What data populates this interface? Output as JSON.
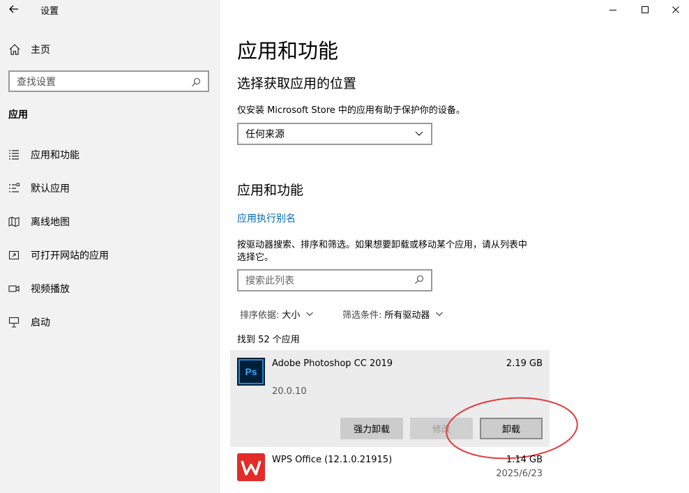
{
  "window": {
    "title": "设置",
    "controls": [
      "minimize-icon",
      "maximize-icon",
      "close-icon"
    ]
  },
  "sidebar": {
    "home_label": "主页",
    "search_placeholder": "查找设置",
    "section": "应用",
    "items": [
      {
        "label": "应用和功能",
        "icon": "apps-list-icon"
      },
      {
        "label": "默认应用",
        "icon": "default-apps-icon"
      },
      {
        "label": "离线地图",
        "icon": "map-icon"
      },
      {
        "label": "可打开网站的应用",
        "icon": "open-website-icon"
      },
      {
        "label": "视频播放",
        "icon": "video-icon"
      },
      {
        "label": "启动",
        "icon": "startup-icon"
      }
    ]
  },
  "main": {
    "page_title": "应用和功能",
    "location_heading": "选择获取应用的位置",
    "location_desc": "仅安装 Microsoft Store 中的应用有助于保护你的设备。",
    "location_value": "任何来源",
    "apps_heading": "应用和功能",
    "alias_link": "应用执行别名",
    "apps_desc_line1": "按驱动器搜索、排序和筛选。如果想要卸载或移动某个应用，请从列表中",
    "apps_desc_line2": "选择它。",
    "search_placeholder": "搜索此列表",
    "sort_label": "排序依据:",
    "sort_value": "大小",
    "filter_label": "筛选条件:",
    "filter_value": "所有驱动器",
    "count_text": "找到 52 个应用",
    "apps": [
      {
        "name": "Adobe Photoshop CC 2019",
        "size": "2.19 GB",
        "version": "20.0.10",
        "icon_text": "Ps",
        "buttons": {
          "force_uninstall": "强力卸载",
          "modify": "修改",
          "uninstall": "卸载"
        }
      },
      {
        "name": "WPS Office (12.1.0.21915)",
        "size": "1.14 GB",
        "date": "2025/6/23"
      }
    ]
  },
  "colors": {
    "accent_link": "#0067b8",
    "ps_icon_bg": "#001e36",
    "ps_icon_fg": "#31a8ff",
    "wps_red": "#e22c29",
    "annotation_red": "#e23b3b"
  }
}
